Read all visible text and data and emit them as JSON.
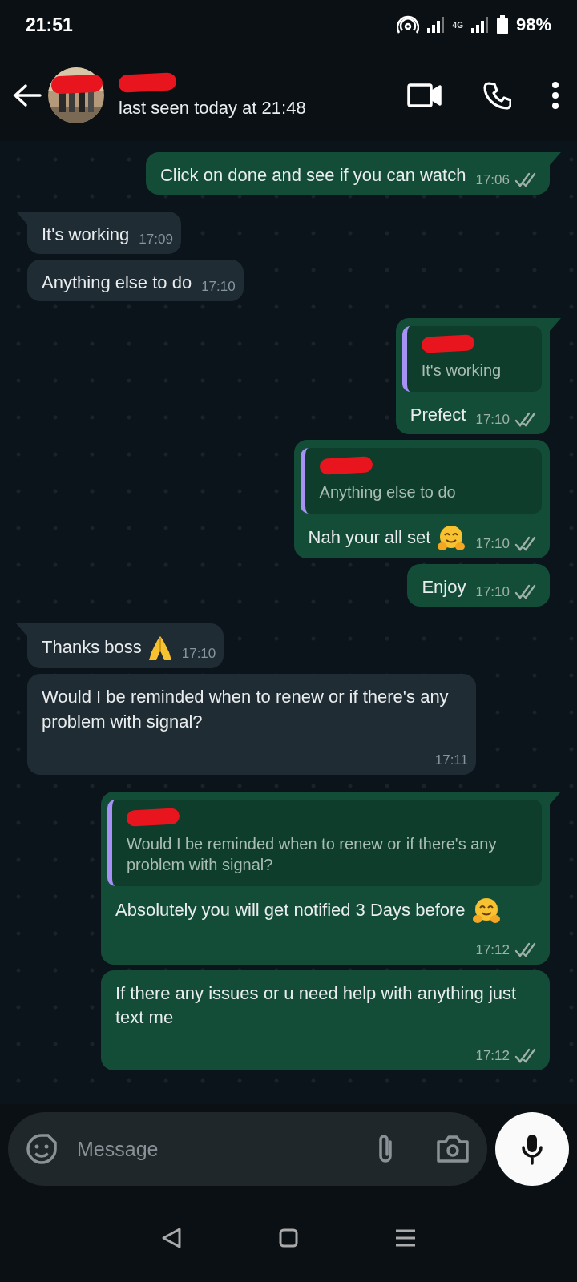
{
  "status_bar": {
    "time": "21:51",
    "network": "4G",
    "battery": "98%"
  },
  "header": {
    "avatar_redacted": true,
    "name_redacted": true,
    "last_seen": "last seen today at 21:48"
  },
  "messages": [
    {
      "kind": "outgoing",
      "tail": true,
      "text": "Click on done and see if you can watch",
      "time": "17:06",
      "delivered": true
    },
    {
      "kind": "incoming",
      "tail": true,
      "text": "It's working",
      "time": "17:09"
    },
    {
      "kind": "incoming",
      "tail": false,
      "text": "Anything else to do",
      "time": "17:10"
    },
    {
      "kind": "outgoing",
      "tail": true,
      "quote": {
        "name_redacted": true,
        "text": "It's working"
      },
      "text": "Prefect",
      "time": "17:10",
      "delivered": true
    },
    {
      "kind": "outgoing",
      "tail": false,
      "quote": {
        "name_redacted": true,
        "text": "Anything else to do"
      },
      "text": "Nah your all set",
      "emoji": {
        "kind": "hug"
      },
      "time": "17:10",
      "delivered": true
    },
    {
      "kind": "outgoing",
      "tail": false,
      "text": "Enjoy",
      "time": "17:10",
      "delivered": true
    },
    {
      "kind": "incoming",
      "tail": true,
      "text": "Thanks boss",
      "emoji": {
        "kind": "pray"
      },
      "time": "17:10"
    },
    {
      "kind": "incoming",
      "tail": false,
      "text": "Would I be reminded when to renew or if there's any problem with signal?",
      "time": "17:11"
    },
    {
      "kind": "outgoing",
      "tail": true,
      "quote": {
        "name_redacted": true,
        "text": "Would I be reminded when to renew or if there's any problem with signal?"
      },
      "text": "Absolutely you will get notified 3 Days before",
      "emoji": {
        "kind": "hug"
      },
      "time": "17:12",
      "delivered": true
    },
    {
      "kind": "outgoing",
      "tail": false,
      "text": "If there any issues or u need help with anything just text me",
      "time": "17:12",
      "delivered": true
    }
  ],
  "composer": {
    "placeholder": "Message"
  }
}
